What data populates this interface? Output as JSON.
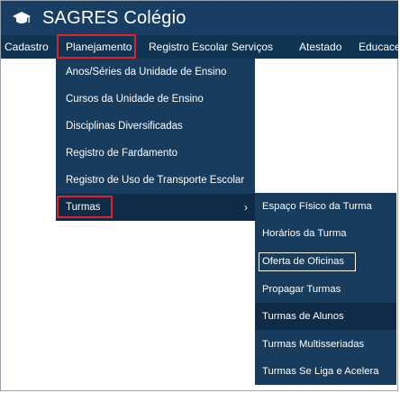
{
  "app": {
    "title": "SAGRES Colégio",
    "logo_icon": "graduation-cap-icon"
  },
  "menubar": {
    "items": [
      {
        "label": "Cadastro"
      },
      {
        "label": "Planejamento"
      },
      {
        "label": "Registro Escolar"
      },
      {
        "label": "Serviços"
      },
      {
        "label": "Atestado"
      },
      {
        "label": "Educaceo"
      }
    ],
    "selected": "Planejamento"
  },
  "planejamento_menu": {
    "items": [
      {
        "label": "Anos/Séries da Unidade de Ensino"
      },
      {
        "label": "Cursos da Unidade de Ensino"
      },
      {
        "label": "Disciplinas Diversificadas"
      },
      {
        "label": "Registro de Fardamento"
      },
      {
        "label": "Registro de Uso de Transporte Escolar"
      },
      {
        "label": "Turmas",
        "submenu_indicator": "›"
      }
    ],
    "selected": "Turmas"
  },
  "turmas_submenu": {
    "items": [
      {
        "label": "Espaço Físico da Turma"
      },
      {
        "label": "Horários da Turma"
      },
      {
        "label": "Oferta de Oficinas"
      },
      {
        "label": "Propagar Turmas"
      },
      {
        "label": "Turmas de Alunos"
      },
      {
        "label": "Turmas Multisseriadas"
      },
      {
        "label": "Turmas Se Liga e Acelera"
      }
    ],
    "focused": "Oferta de Oficinas",
    "hovered": "Turmas de Alunos"
  },
  "colors": {
    "titlebar": "#183f63",
    "menubar": "#0f3454",
    "dropdown": "#173c5e",
    "active_item": "#0e2b47",
    "highlight_box": "#e0202a"
  }
}
